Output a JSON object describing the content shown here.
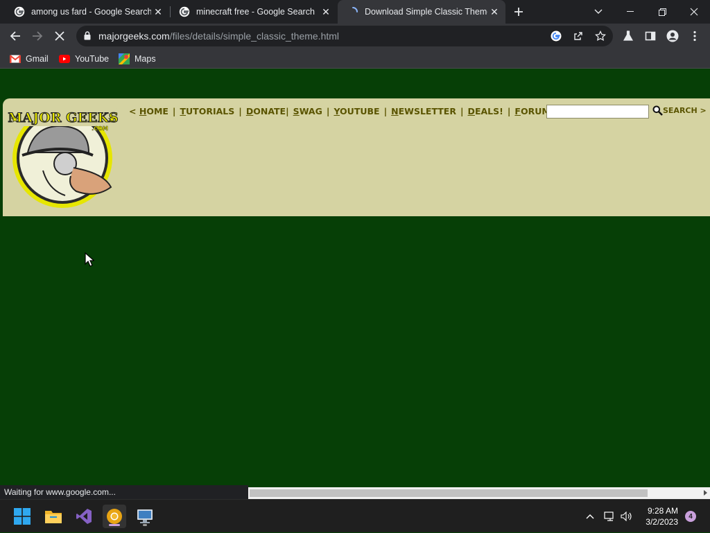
{
  "browser": {
    "tabs": [
      {
        "title": "among us fard - Google Search",
        "favicon": "google-g-icon"
      },
      {
        "title": "minecraft free - Google Search",
        "favicon": "google-g-icon"
      },
      {
        "title": "Download Simple Classic Theme",
        "favicon": "loading-spinner-icon",
        "active": true
      }
    ],
    "url_host": "majorgeeks.com",
    "url_path": "/files/details/simple_classic_theme.html",
    "bookmarks": [
      {
        "label": "Gmail",
        "icon": "gmail-icon"
      },
      {
        "label": "YouTube",
        "icon": "youtube-icon"
      },
      {
        "label": "Maps",
        "icon": "maps-icon"
      }
    ],
    "status_text": "Waiting for www.google.com..."
  },
  "site": {
    "logo_text": "MAJOR GEEKS",
    "logo_subtext": ".COM",
    "nav": {
      "prefix": "<",
      "items": [
        {
          "first": "H",
          "rest": "OME"
        },
        {
          "first": "T",
          "rest": "UTORIALS"
        },
        {
          "first": "D",
          "rest": "ONATE"
        },
        {
          "first": "S",
          "rest": "WAG"
        },
        {
          "first": "Y",
          "rest": "OUTUBE"
        },
        {
          "first": "N",
          "rest": "EWSLETTER"
        },
        {
          "first": "D",
          "rest": "EALS!"
        },
        {
          "first": "F",
          "rest": "ORUMS"
        }
      ],
      "separator": "|"
    },
    "search_value": "",
    "search_label": "SEARCH >"
  },
  "taskbar": {
    "time": "9:28 AM",
    "date": "3/2/2023",
    "notification_count": "4"
  },
  "colors": {
    "page_bg": "#063f06",
    "header_bg": "#d5d3a2",
    "nav_text": "#5a5400"
  }
}
